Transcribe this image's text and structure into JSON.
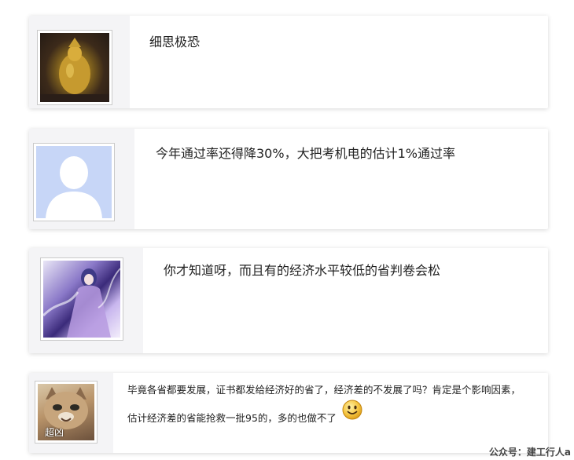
{
  "comments": [
    {
      "text": "细思极恐"
    },
    {
      "text": "今年通过率还得降30%，大把考机电的估计1%通过率"
    },
    {
      "text": "你才知道呀，而且有的经济水平较低的省判卷会松"
    },
    {
      "line1": "毕竟各省都要发展，证书都发给经济好的省了，经济差的不发展了吗？肯定是个影响因素，",
      "line2": "估计经济差的省能抢救一批95的，多的也做不了",
      "avatar_caption": "超凶",
      "emoji": "smiley-face"
    }
  ],
  "footer": {
    "watermark": "公众号：建工行人a"
  }
}
